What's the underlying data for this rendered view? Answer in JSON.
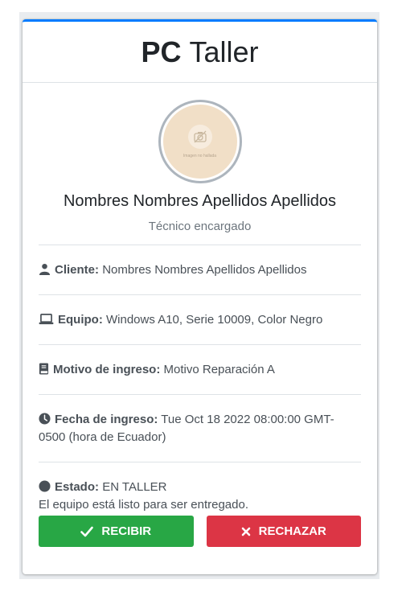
{
  "header": {
    "brand_bold": "PC",
    "brand_rest": "Taller"
  },
  "profile": {
    "avatar_placeholder": "Imagen no hallada",
    "name": "Nombres Nombres Apellidos Apellidos",
    "role": "Técnico encargado"
  },
  "details": {
    "cliente": {
      "label": "Cliente:",
      "value": "Nombres Nombres Apellidos Apellidos",
      "icon": "user-icon"
    },
    "equipo": {
      "label": "Equipo:",
      "value": "Windows A10, Serie 10009, Color Negro",
      "icon": "laptop-icon"
    },
    "motivo": {
      "label": "Motivo de ingreso:",
      "value": "Motivo Reparación A",
      "icon": "book-icon"
    },
    "fecha": {
      "label": "Fecha de ingreso:",
      "value": "Tue Oct 18 2022 08:00:00 GMT-0500 (hora de Ecuador)",
      "icon": "clock-icon"
    },
    "estado": {
      "label": "Estado:",
      "value": "EN TALLER",
      "note": "El equipo está listo para ser entregado.",
      "icon": "circle-icon"
    }
  },
  "actions": {
    "accept": "RECIBIR",
    "reject": "RECHAZAR"
  },
  "colors": {
    "accent": "#007bff",
    "success": "#28a745",
    "danger": "#dc3545"
  }
}
